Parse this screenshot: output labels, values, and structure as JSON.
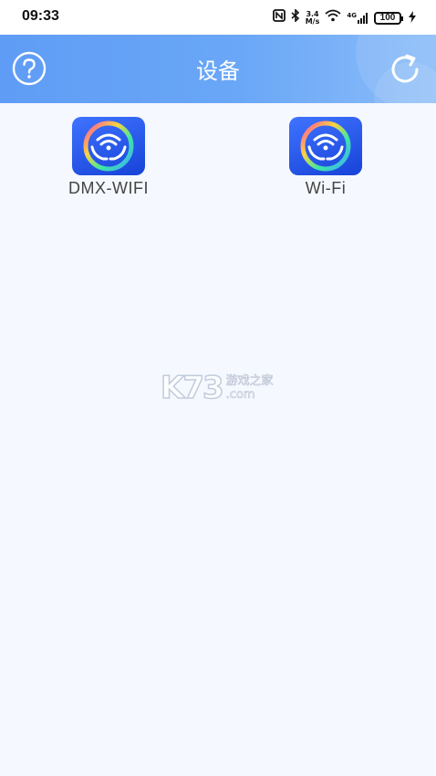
{
  "status_bar": {
    "time": "09:33",
    "network_speed_value": "3.4",
    "network_speed_unit": "M/s",
    "signal_label": "4G",
    "battery": "100"
  },
  "header": {
    "title": "设备",
    "left_icon": "help-circle-icon",
    "right_icon": "refresh-icon",
    "color_start": "#5f9cf5",
    "color_end": "#8bbcf8"
  },
  "devices": [
    {
      "label": "DMX-WIFI",
      "icon": "wifi-hands-icon"
    },
    {
      "label": "Wi-Fi",
      "icon": "wifi-hands-icon"
    }
  ],
  "watermark": {
    "brand": "K73",
    "chinese": "游戏之家",
    "domain": ".com"
  }
}
